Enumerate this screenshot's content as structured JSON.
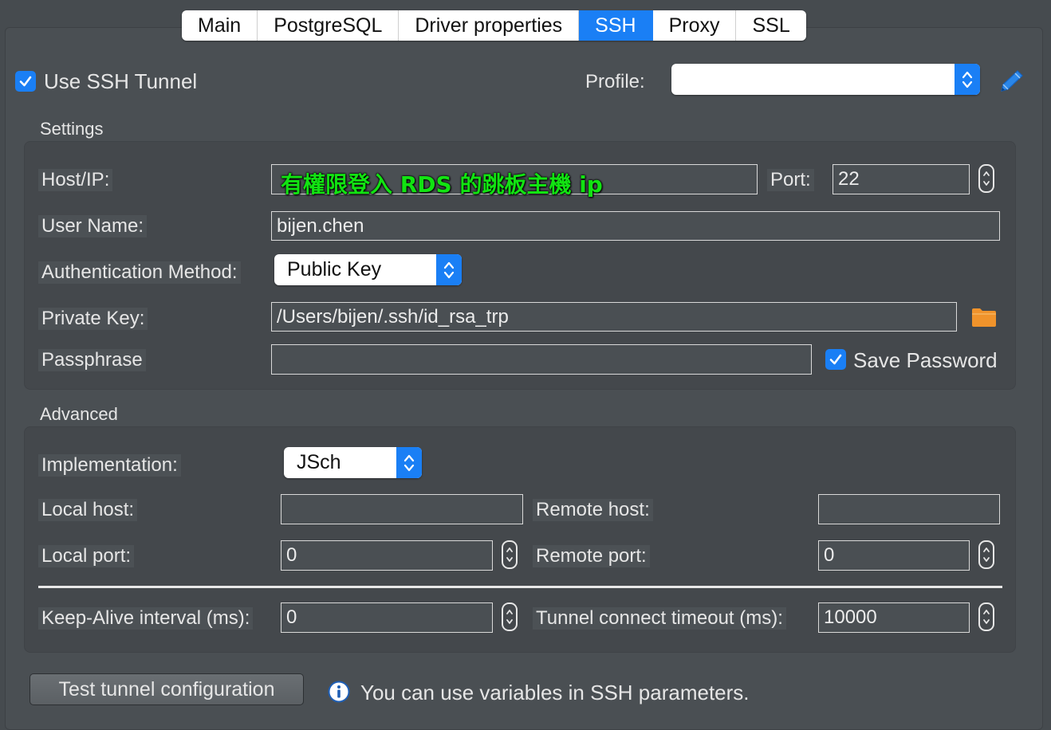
{
  "tabs": [
    {
      "label": "Main",
      "active": false
    },
    {
      "label": "PostgreSQL",
      "active": false
    },
    {
      "label": "Driver properties",
      "active": false
    },
    {
      "label": "SSH",
      "active": true
    },
    {
      "label": "Proxy",
      "active": false
    },
    {
      "label": "SSL",
      "active": false
    }
  ],
  "header": {
    "use_ssh_tunnel_label": "Use SSH Tunnel",
    "use_ssh_tunnel_checked": true,
    "profile_label": "Profile:",
    "profile_value": ""
  },
  "settings": {
    "title": "Settings",
    "host_label": "Host/IP:",
    "host_value": "",
    "host_annotation": "有權限登入 RDS 的跳板主機 ip",
    "port_label": "Port:",
    "port_value": "22",
    "user_label": "User Name:",
    "user_value": "bijen.chen",
    "auth_label": "Authentication Method:",
    "auth_value": "Public Key",
    "key_label": "Private Key:",
    "key_value": "/Users/bijen/.ssh/id_rsa_trp",
    "pass_label": "Passphrase",
    "pass_value": "",
    "save_password_label": "Save Password",
    "save_password_checked": true
  },
  "advanced": {
    "title": "Advanced",
    "impl_label": "Implementation:",
    "impl_value": "JSch",
    "local_host_label": "Local host:",
    "local_host_value": "",
    "remote_host_label": "Remote host:",
    "remote_host_value": "",
    "local_port_label": "Local port:",
    "local_port_value": "0",
    "remote_port_label": "Remote port:",
    "remote_port_value": "0",
    "keepalive_label": "Keep-Alive interval (ms):",
    "keepalive_value": "0",
    "timeout_label": "Tunnel connect timeout (ms):",
    "timeout_value": "10000"
  },
  "footer": {
    "test_button_label": "Test tunnel configuration",
    "info_text": "You can use variables in SSH parameters."
  },
  "colors": {
    "accent": "#1a7ff5",
    "background": "#464b4f",
    "folder": "#f0932b",
    "annotation": "#12e312"
  },
  "icons": [
    "checkmark-icon",
    "updown-chevron-icon",
    "pencil-icon",
    "folder-icon",
    "info-icon"
  ]
}
